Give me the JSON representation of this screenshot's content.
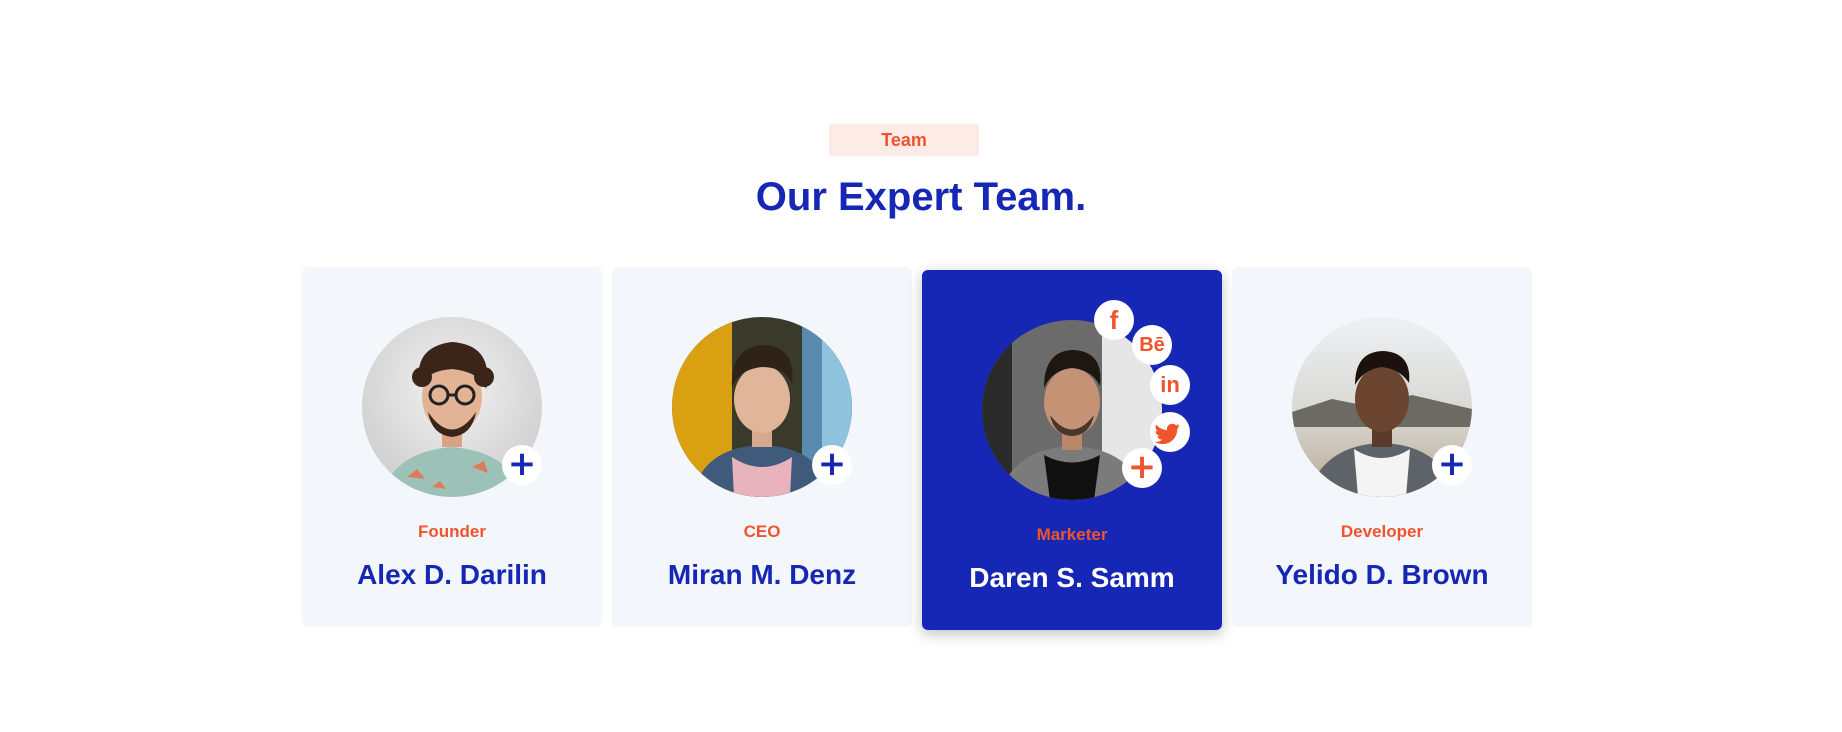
{
  "section": {
    "tag": "Team",
    "title": "Our Expert Team."
  },
  "team": [
    {
      "role": "Founder",
      "name": "Alex D. Darilin",
      "plus_label": "+"
    },
    {
      "role": "CEO",
      "name": "Miran M. Denz",
      "plus_label": "+"
    },
    {
      "role": "Marketer",
      "name": "Daren S. Samm",
      "plus_label": "+",
      "active": true
    },
    {
      "role": "Developer",
      "name": "Yelido D. Brown",
      "plus_label": "+"
    }
  ],
  "social": {
    "facebook": "f",
    "behance": "Bē",
    "linkedin": "in",
    "twitter": "twitter-icon"
  },
  "colors": {
    "brand_blue": "#1627b5",
    "accent_orange": "#f0542d",
    "card_bg": "#f3f7fc",
    "tag_bg": "#fcebe6"
  }
}
